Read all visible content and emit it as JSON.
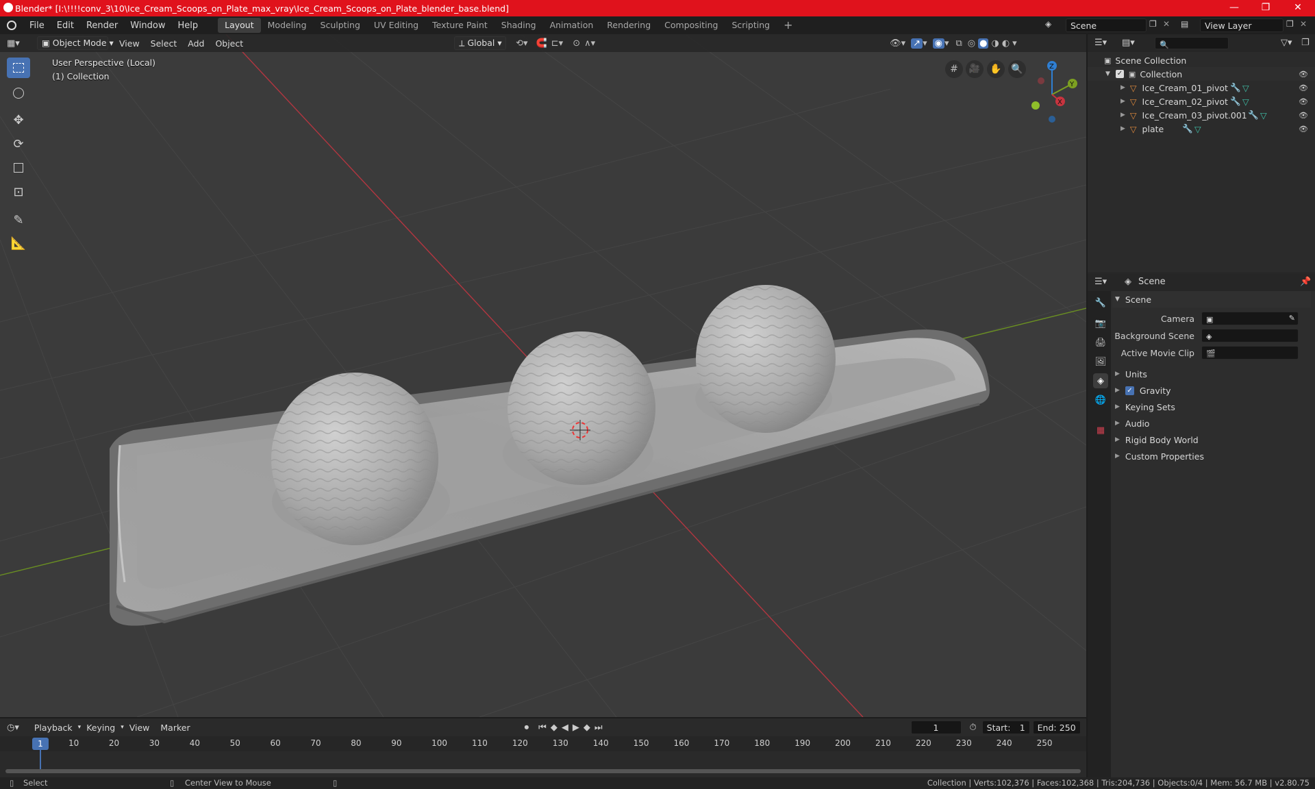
{
  "window": {
    "title": "Blender* [I:\\!!!!conv_3\\10\\Ice_Cream_Scoops_on_Plate_max_vray\\Ice_Cream_Scoops_on_Plate_blender_base.blend]",
    "controls": [
      "—",
      "❐",
      "✕"
    ]
  },
  "menu": [
    "File",
    "Edit",
    "Render",
    "Window",
    "Help"
  ],
  "workspaces": [
    "Layout",
    "Modeling",
    "Sculpting",
    "UV Editing",
    "Texture Paint",
    "Shading",
    "Animation",
    "Rendering",
    "Compositing",
    "Scripting"
  ],
  "active_workspace": "Layout",
  "scene_field": "Scene",
  "view_layer_field": "View Layer",
  "viewport_header": {
    "mode": "Object Mode",
    "menus": [
      "View",
      "Select",
      "Add",
      "Object"
    ],
    "transform_orientation": "Global"
  },
  "viewport": {
    "overlay_line1": "User Perspective (Local)",
    "overlay_line2": "(1) Collection",
    "gizmo_axes": [
      "Z",
      "Y",
      "X"
    ]
  },
  "outliner": {
    "root": "Scene Collection",
    "collection": "Collection",
    "objects": [
      "Ice_Cream_01_pivot",
      "Ice_Cream_02_pivot",
      "Ice_Cream_03_pivot.001",
      "plate"
    ]
  },
  "properties": {
    "header": "Scene",
    "panel": "Scene",
    "fields": [
      {
        "label": "Camera",
        "value": ""
      },
      {
        "label": "Background Scene",
        "value": ""
      },
      {
        "label": "Active Movie Clip",
        "value": ""
      }
    ],
    "subpanels": [
      "Units",
      "Gravity",
      "Keying Sets",
      "Audio",
      "Rigid Body World",
      "Custom Properties"
    ],
    "gravity_checked": true
  },
  "timeline": {
    "menus": [
      "Playback",
      "Keying",
      "View",
      "Marker"
    ],
    "current_frame": "1",
    "start_label": "Start:",
    "start": "1",
    "end_label": "End:",
    "end": "250",
    "ruler": [
      "10",
      "20",
      "30",
      "40",
      "50",
      "60",
      "70",
      "80",
      "90",
      "100",
      "110",
      "120",
      "130",
      "140",
      "150",
      "160",
      "170",
      "180",
      "190",
      "200",
      "210",
      "220",
      "230",
      "240",
      "250"
    ],
    "playhead_label": "1"
  },
  "statusbar": {
    "left_action": "Select",
    "middle_action": "Center View to Mouse",
    "stats": "Collection | Verts:102,376 | Faces:102,368 | Tris:204,736 | Objects:0/4 | Mem: 56.7 MB | v2.80.75"
  },
  "colors": {
    "titlebar": "#e0121c",
    "active_blue": "#4772b3",
    "viewport_bg": "#3b3b3b",
    "x_axis": "#c8343f",
    "y_axis": "#7ca021",
    "z_axis": "#2f7fd3"
  }
}
